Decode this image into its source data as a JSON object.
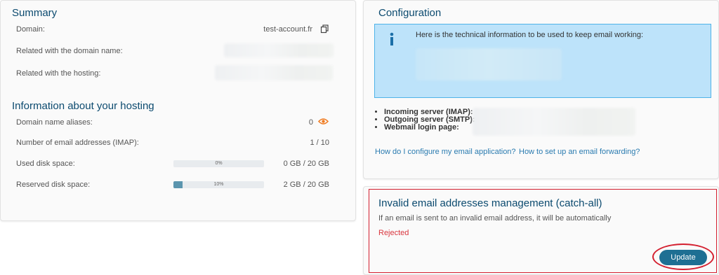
{
  "summary": {
    "title": "Summary",
    "domain_label": "Domain:",
    "domain_value": "test-account.fr",
    "related_domain_label": "Related with the domain name:",
    "related_hosting_label": "Related with the hosting:"
  },
  "hosting": {
    "title": "Information about your hosting",
    "aliases_label": "Domain name aliases:",
    "aliases_value": "0",
    "email_label": "Number of email addresses (IMAP):",
    "email_value": "1 / 10",
    "used_label": "Used disk space:",
    "used_percent_text": "0%",
    "used_percent": 0,
    "used_value": "0 GB / 20 GB",
    "reserved_label": "Reserved disk space:",
    "reserved_percent_text": "10%",
    "reserved_percent": 10,
    "reserved_value": "2 GB / 20 GB"
  },
  "configuration": {
    "title": "Configuration",
    "info_text": "Here is the technical information to be used to keep email working:",
    "incoming_label": "Incoming server (IMAP):",
    "outgoing_label": "Outgoing server (SMTP):",
    "webmail_label": "Webmail login page:",
    "link_configure": "How do I configure my email application?",
    "link_forwarding": "How to set up an email forwarding?"
  },
  "catchall": {
    "title": "Invalid email addresses management (catch-all)",
    "description": "If an email is sent to an invalid email address, it will be automatically",
    "status": "Rejected",
    "update_label": "Update"
  },
  "colors": {
    "title": "#0b4a6f",
    "link": "#2a7bb0",
    "info_bg": "#bde3fa",
    "info_border": "#4fb3e8",
    "status_red": "#d9363e",
    "button": "#1e6f93",
    "highlight": "#d42030",
    "eye_icon": "#f07c22"
  },
  "icons": {
    "copy": "copy-icon",
    "eye": "eye-icon",
    "info": "info-icon"
  }
}
